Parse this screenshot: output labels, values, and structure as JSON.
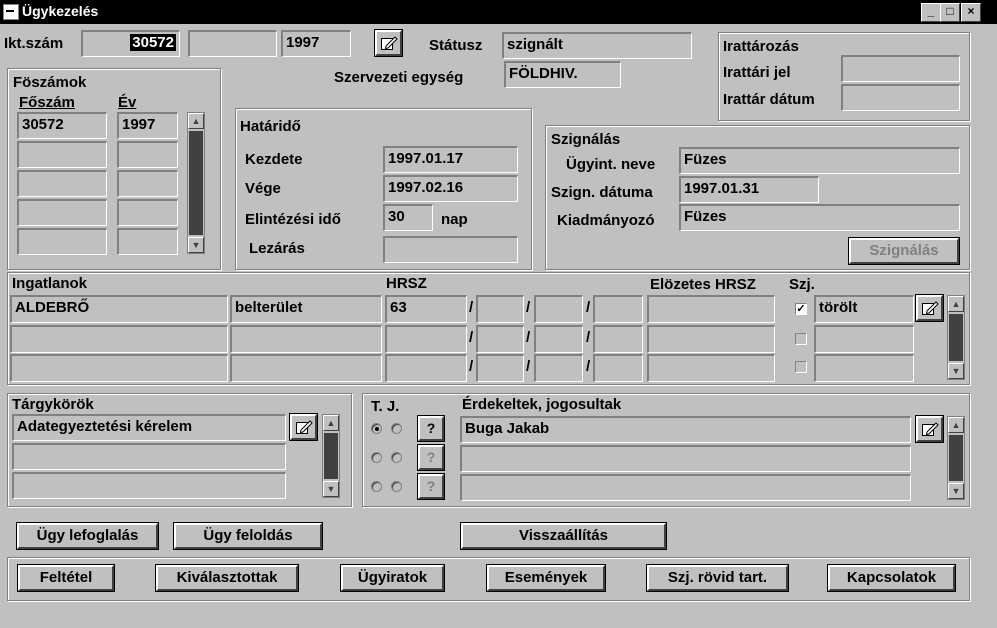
{
  "window": {
    "title": "Ügykezelés",
    "minimize": "_",
    "maximize": "□",
    "close": "×"
  },
  "header": {
    "ikt_label": "Ikt.szám",
    "ikt_value": "30572",
    "ikt_extra": "",
    "year": "1997",
    "status_label": "Státusz",
    "status_value": "szignált",
    "org_label": "Szervezeti egység",
    "org_value": "FÖLDHIV."
  },
  "archive": {
    "title": "Irattározás",
    "mark_label": "Irattári jel",
    "mark_value": "",
    "date_label": "Irattár dátum",
    "date_value": ""
  },
  "main_numbers": {
    "title": "Föszámok",
    "col_main": "Főszám",
    "col_year": "Év",
    "rows": [
      {
        "main": "30572",
        "year": "1997"
      },
      {
        "main": "",
        "year": ""
      },
      {
        "main": "",
        "year": ""
      },
      {
        "main": "",
        "year": ""
      },
      {
        "main": "",
        "year": ""
      }
    ]
  },
  "deadline": {
    "title": "Határidő",
    "start_label": "Kezdete",
    "start_value": "1997.01.17",
    "end_label": "Vége",
    "end_value": "1997.02.16",
    "duration_label": "Elintézési idő",
    "duration_value": "30",
    "duration_unit": "nap",
    "close_label": "Lezárás",
    "close_value": ""
  },
  "assignment": {
    "title": "Szignálás",
    "clerk_label": "Ügyint. neve",
    "clerk_value": "Füzes",
    "date_label": "Szign. dátuma",
    "date_value": "1997.01.31",
    "issuer_label": "Kiadmányozó",
    "issuer_value": "Füzes",
    "button": "Szignálás"
  },
  "properties": {
    "title": "Ingatlanok",
    "hrsz_label": "HRSZ",
    "prev_hrsz_label": "Elözetes HRSZ",
    "szj_label": "Szj.",
    "slash": "/",
    "rows": [
      {
        "place": "ALDEBRŐ",
        "type": "belterület",
        "h1": "63",
        "h2": "",
        "h3": "",
        "h4": "",
        "prev": "",
        "checked": "✓",
        "status": "törölt"
      },
      {
        "place": "",
        "type": "",
        "h1": "",
        "h2": "",
        "h3": "",
        "h4": "",
        "prev": "",
        "checked": "",
        "status": ""
      },
      {
        "place": "",
        "type": "",
        "h1": "",
        "h2": "",
        "h3": "",
        "h4": "",
        "prev": "",
        "checked": "",
        "status": ""
      }
    ]
  },
  "subjects": {
    "title": "Tárgykörök",
    "rows": [
      "Adategyeztetési kérelem",
      "",
      ""
    ]
  },
  "parties": {
    "tj_label": "T. J.",
    "title": "Érdekeltek, jogosultak",
    "query": "?",
    "rows": [
      "Buga Jakab",
      "",
      ""
    ]
  },
  "buttons": {
    "reserve": "Ügy lefoglalás",
    "release": "Ügy feloldás",
    "restore": "Visszaállítás",
    "condition": "Feltétel",
    "selected": "Kiválasztottak",
    "documents": "Ügyiratok",
    "events": "Események",
    "short_content": "Szj. rövid tart.",
    "connections": "Kapcsolatok"
  },
  "icons": {
    "edit": "edit-pencil-icon",
    "scroll_up": "arrow-up-icon",
    "scroll_down": "arrow-down-icon"
  }
}
